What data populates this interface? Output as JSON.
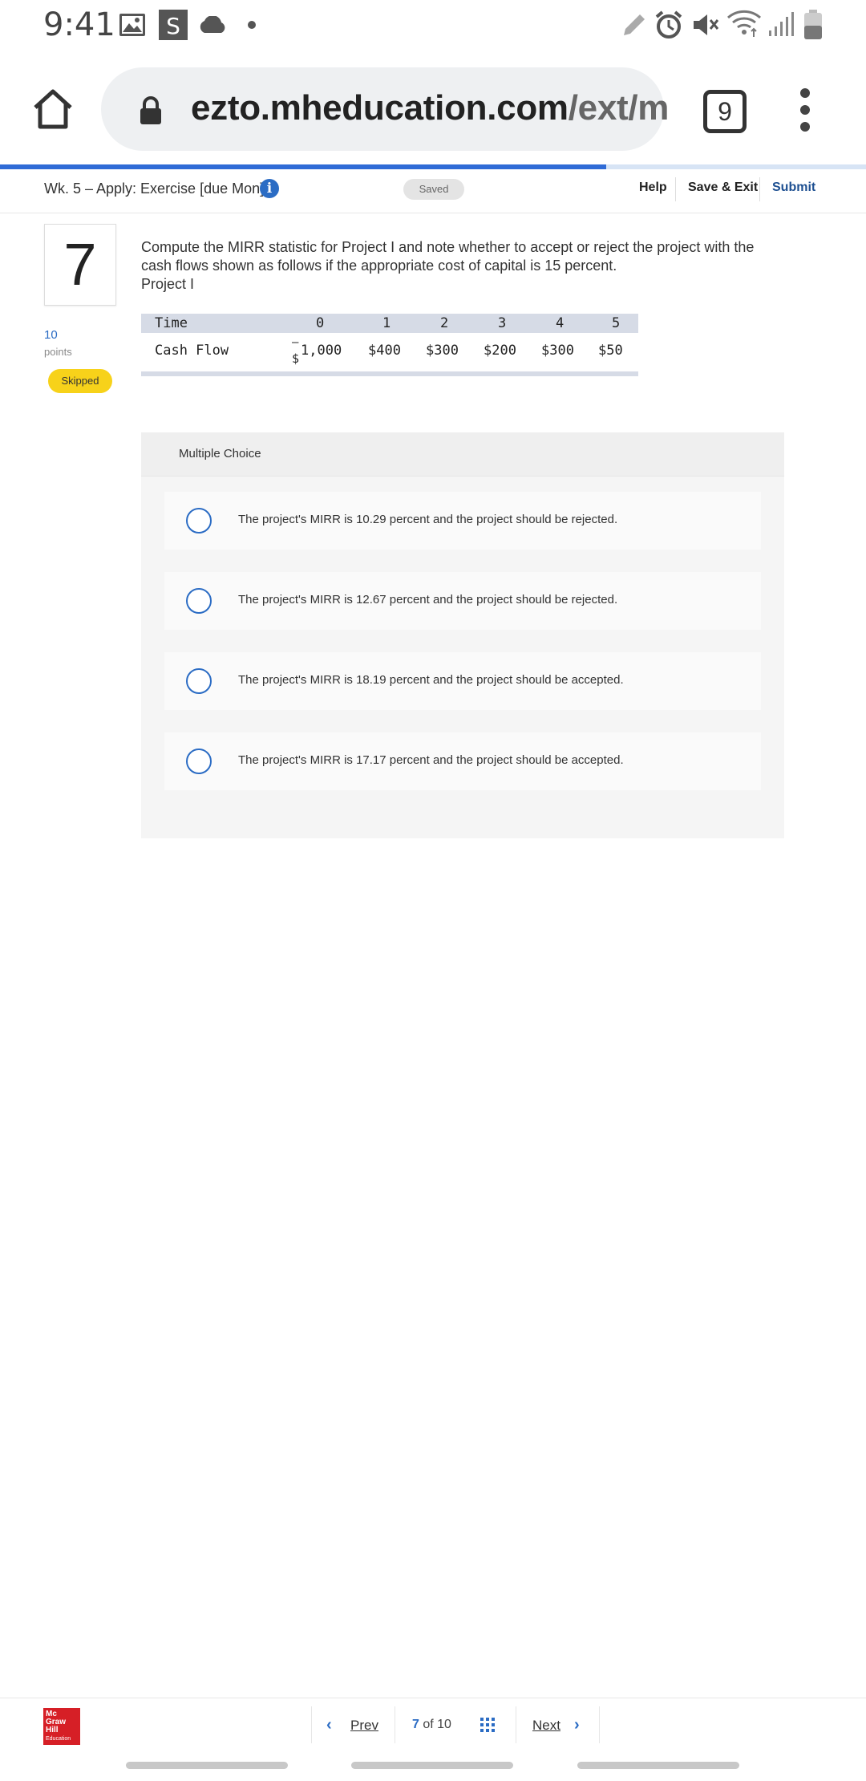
{
  "status_bar": {
    "time": "9:41",
    "left_icons": [
      "image-icon",
      "s-app-icon",
      "cloud-icon",
      "dot-icon"
    ],
    "right_icons": [
      "pen-icon",
      "alarm-icon",
      "mute-icon",
      "wifi-icon",
      "signal-icon",
      "battery-icon"
    ]
  },
  "browser": {
    "url_host": "ezto.mheducation.com",
    "url_path": "/ext/m",
    "tab_count": "9",
    "load_progress": 0.7
  },
  "header": {
    "title": "Wk. 5 – Apply: Exercise [due Mon]",
    "info_glyph": "i",
    "saved_label": "Saved",
    "help": "Help",
    "save_exit": "Save & Exit",
    "submit": "Submit"
  },
  "question": {
    "number": "7",
    "points_value": "10",
    "points_label": "points",
    "status_badge": "Skipped",
    "prompt": "Compute the MIRR statistic for Project I and note whether to accept or reject the project with the cash flows shown as follows if the appropriate cost of capital is 15 percent.",
    "project_label": "Project I",
    "table": {
      "row_header_time": "Time",
      "row_header_cash": "Cash Flow",
      "periods": [
        "0",
        "1",
        "2",
        "3",
        "4",
        "5"
      ],
      "first_cash_sign": "–",
      "first_cash_dollar": "$",
      "first_cash_value": "1,000",
      "cash_flows": [
        "$400",
        "$300",
        "$200",
        "$300",
        "$50"
      ]
    }
  },
  "multiple_choice": {
    "title": "Multiple Choice",
    "options": [
      "The project's MIRR is 10.29 percent and the project should be rejected.",
      "The project's MIRR is 12.67 percent and the project should be rejected.",
      "The project's MIRR is 18.19 percent and the project should be accepted.",
      "The project's MIRR is 17.17 percent and the project should be accepted."
    ]
  },
  "footer": {
    "logo_lines": [
      "Mc",
      "Graw",
      "Hill",
      "Education"
    ],
    "prev": "Prev",
    "current_page": "7",
    "of_label": "of",
    "total_pages": "10",
    "next": "Next"
  },
  "colors": {
    "accent_blue": "#2b6cc4",
    "progress_blue": "#2f6bd6",
    "skipped_yellow": "#f7d21a",
    "brand_red": "#d61f26"
  }
}
